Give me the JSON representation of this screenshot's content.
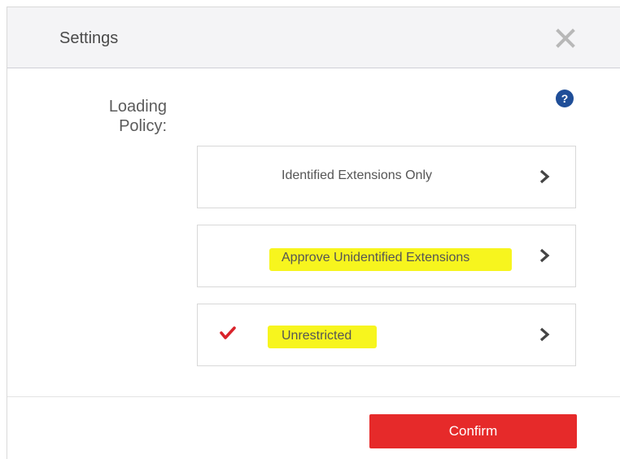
{
  "dialog": {
    "title": "Settings",
    "close_icon": "close-icon",
    "help_icon": "help-icon",
    "help_glyph": "?",
    "field_label_line1": "Loading",
    "field_label_line2": "Policy:",
    "options": [
      {
        "label": "Identified Extensions Only",
        "selected": false,
        "highlighted": false
      },
      {
        "label": "Approve Unidentified Extensions",
        "selected": false,
        "highlighted": true
      },
      {
        "label": "Unrestricted",
        "selected": true,
        "highlighted": true
      }
    ],
    "confirm_label": "Confirm"
  },
  "colors": {
    "accent": "#e62a2a",
    "highlight": "#f7f51e",
    "help": "#1f4e98",
    "check": "#d9232b"
  }
}
